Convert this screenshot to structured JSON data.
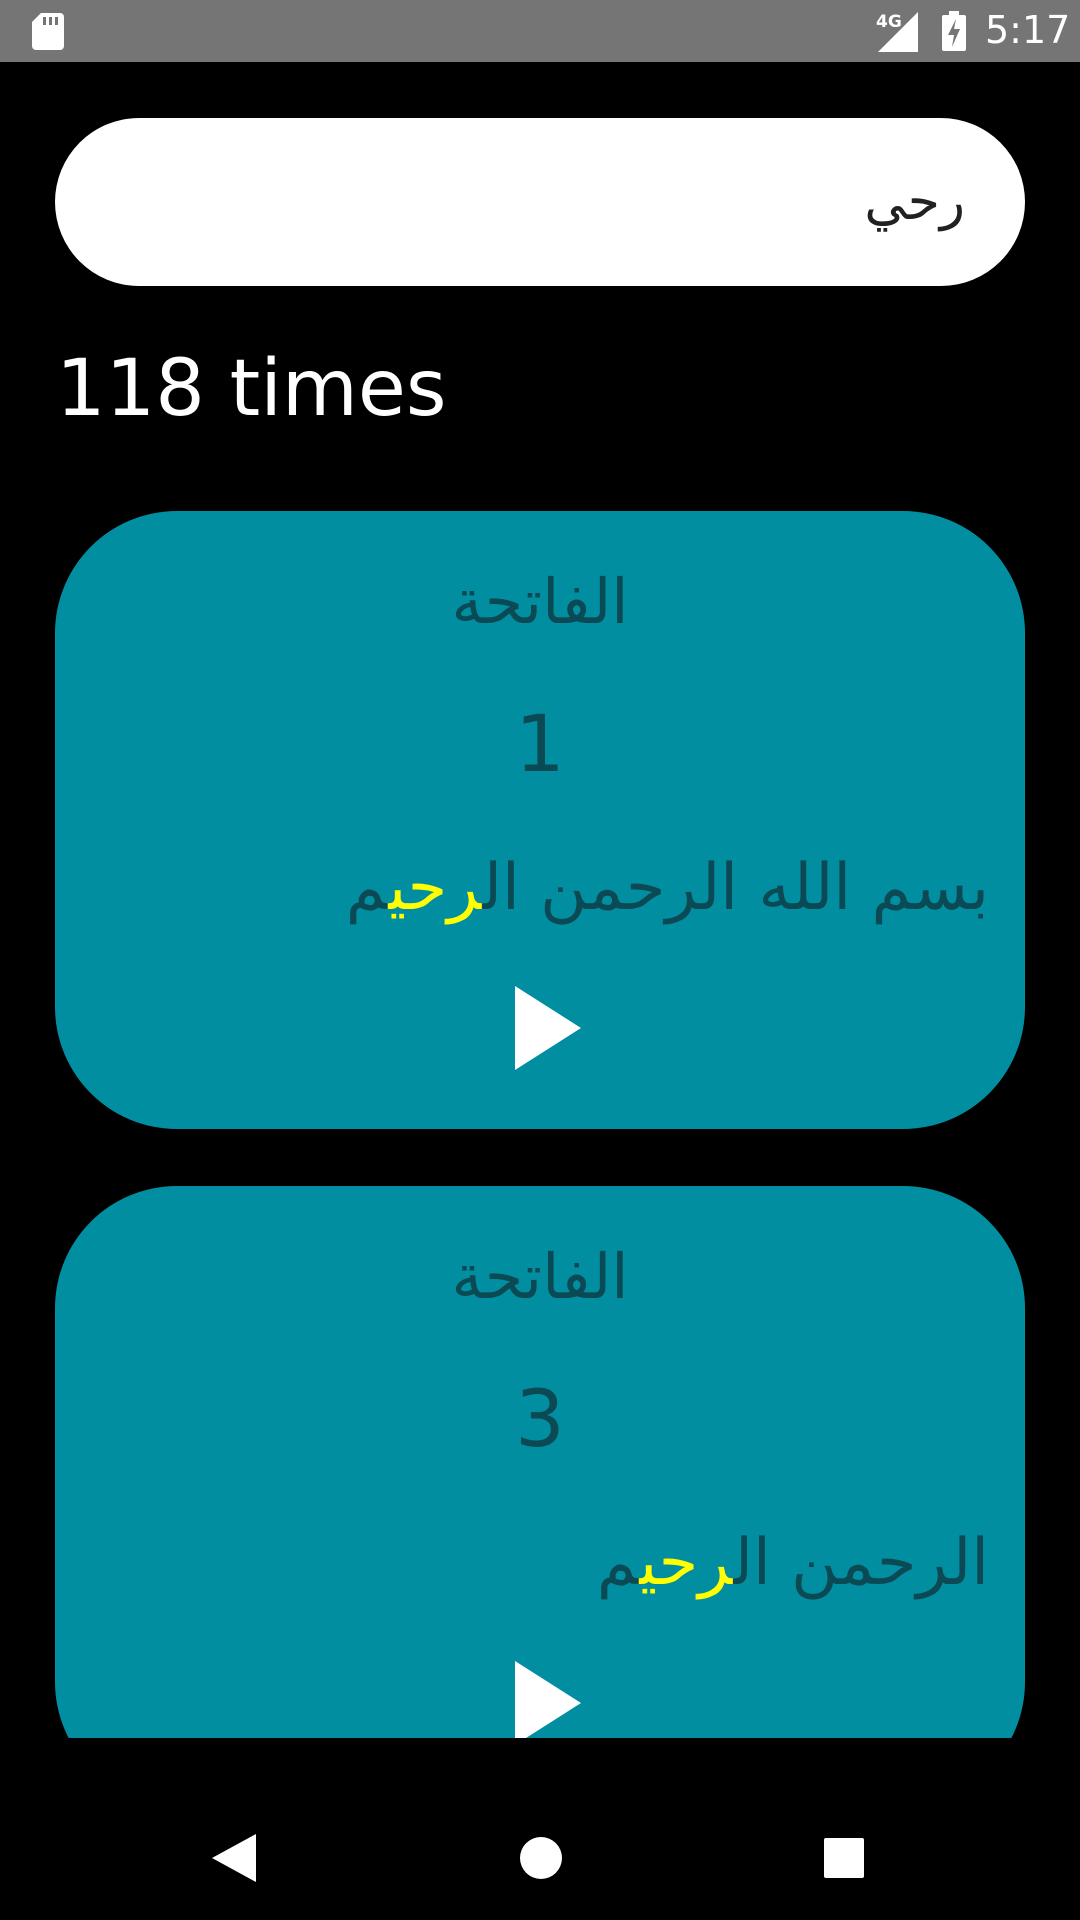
{
  "status_bar": {
    "network_label": "4G",
    "time": "5:17",
    "icons": [
      "sd-card-icon",
      "signal-icon",
      "battery-charging-icon"
    ]
  },
  "search": {
    "value": "رحي",
    "placeholder": ""
  },
  "result_count": "118 times",
  "colors": {
    "background": "#000000",
    "card": "#028ea1",
    "card_text": "#0b4a54",
    "highlight": "#ffff00",
    "search_box": "#ffffff"
  },
  "results": [
    {
      "surah": "الفاتحة",
      "ayah_number": "1",
      "ayah_before": "بسم الله الرحمن ال",
      "ayah_match": "رحي",
      "ayah_after": "م",
      "play_icon": "play-icon"
    },
    {
      "surah": "الفاتحة",
      "ayah_number": "3",
      "ayah_before": "الرحمن ال",
      "ayah_match": "رحي",
      "ayah_after": "م",
      "play_icon": "play-icon"
    }
  ],
  "nav_bar": {
    "icons": [
      "back-icon",
      "home-icon",
      "recents-icon"
    ]
  }
}
